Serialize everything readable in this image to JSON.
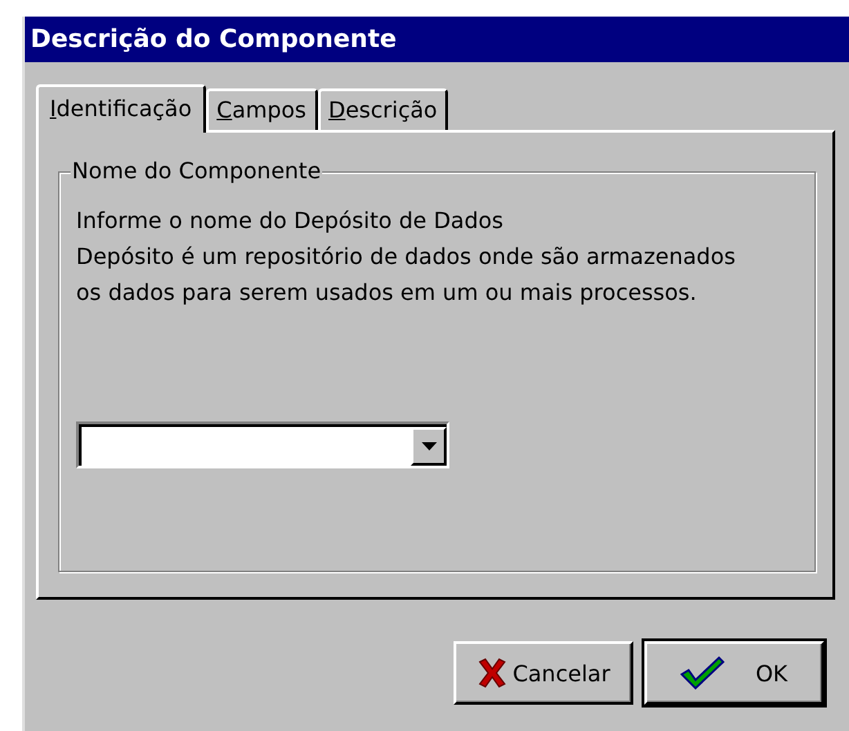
{
  "window": {
    "title": "Descrição do Componente"
  },
  "tabs": [
    {
      "label": "Identificação",
      "selected": true
    },
    {
      "label": "Campos",
      "selected": false
    },
    {
      "label": "Descrição",
      "selected": false
    }
  ],
  "group": {
    "title": "Nome do Componente",
    "lines": [
      "Informe o nome do Depósito de Dados",
      "Depósito é um repositório de dados onde são armazenados",
      "os dados para serem usados em um ou mais processos."
    ]
  },
  "buttons": [
    {
      "label": "Cancelar",
      "kind": "cancel",
      "default": false
    },
    {
      "label": "OK",
      "kind": "ok",
      "default": true
    }
  ]
}
